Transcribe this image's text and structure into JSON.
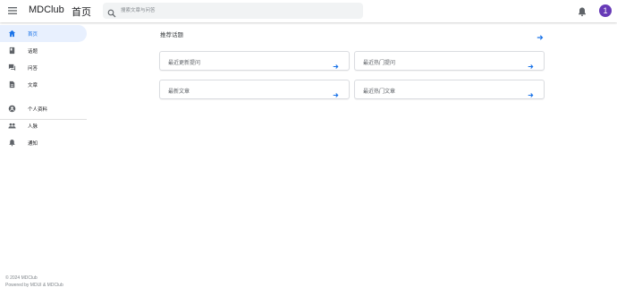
{
  "header": {
    "menu_icon": "menu-icon",
    "brand": "MDClub",
    "page_name": "首页",
    "search_placeholder": "搜索文章与问答",
    "bell_icon": "bell-icon",
    "avatar_text": "1",
    "avatar_color": "#673ab7"
  },
  "sidebar": {
    "items": [
      {
        "label": "首页",
        "icon": "home-icon",
        "active": true
      },
      {
        "label": "话题",
        "icon": "book-icon",
        "active": false
      },
      {
        "label": "问答",
        "icon": "forum-icon",
        "active": false
      },
      {
        "label": "文章",
        "icon": "document-icon",
        "active": false
      },
      {
        "label": "个人资料",
        "icon": "account-circle-icon",
        "active": false
      },
      {
        "label": "人脉",
        "icon": "people-icon",
        "active": false
      },
      {
        "label": "通知",
        "icon": "bell-icon",
        "active": false
      }
    ],
    "footer": {
      "copyright": "© 2024 MDClub",
      "powered": "Powered by MDUI & MDClub"
    }
  },
  "main": {
    "recommend_title": "推荐话题",
    "cards": [
      {
        "label": "最近更新提问"
      },
      {
        "label": "最近热门提问"
      },
      {
        "label": "最新文章"
      },
      {
        "label": "最近热门文章"
      }
    ]
  },
  "colors": {
    "accent": "#1a73e8",
    "active_bg": "#e8f0fe"
  }
}
